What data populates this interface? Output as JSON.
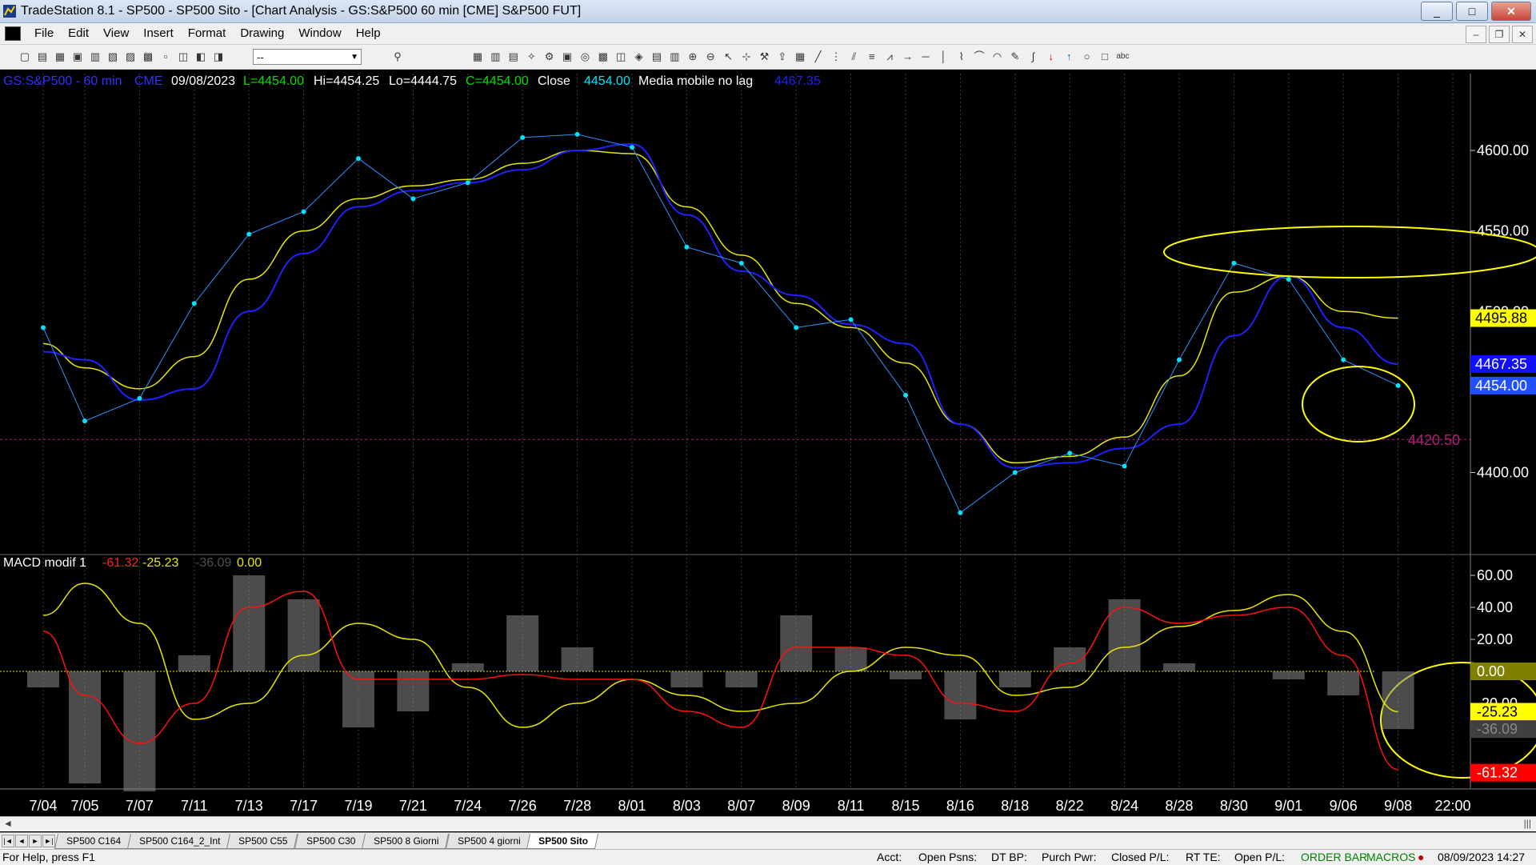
{
  "window": {
    "title": "TradeStation 8.1 - SP500 - SP500 Sito - [Chart Analysis - GS:S&P500  60 min  [CME] S&P500 FUT]",
    "btn_minimize": "_",
    "btn_maximize": "□",
    "btn_close": "✕"
  },
  "menu": {
    "items": [
      "File",
      "Edit",
      "View",
      "Insert",
      "Format",
      "Drawing",
      "Window",
      "Help"
    ],
    "mdi_min": "–",
    "mdi_restore": "❐",
    "mdi_close": "✕"
  },
  "toolbar": {
    "symbol_select": "--"
  },
  "chart": {
    "header": {
      "symbol": "GS:S&P500 - 60 min",
      "exchange": "CME",
      "date": "09/08/2023",
      "last": "L=4454.00",
      "high": "Hi=4454.25",
      "low": "Lo=4444.75",
      "close_val": "C=4454.00",
      "close_label": "Close",
      "close_price": "4454.00",
      "indicator_name": "Media mobile no lag",
      "indicator_value": "4467.35"
    },
    "price_axis": [
      "4600.00",
      "4550.00",
      "4500.00",
      "4400.00"
    ],
    "price_markers": {
      "yellow_ma": "4495.88",
      "blue_ma": "4467.35",
      "last": "4454.00",
      "hline": "4420.50"
    },
    "macd_header": {
      "name": "MACD modif 1",
      "v1": "-61.32",
      "v2": "-25.23",
      "v3": "-36.09",
      "v4": "0.00"
    },
    "macd_axis": [
      "60.00",
      "40.00",
      "20.00",
      "-20.00"
    ],
    "macd_markers": {
      "zero": "0.00",
      "yellow": "-25.23",
      "hist": "-36.09",
      "red": "-61.32"
    },
    "colors": {
      "price_dots": "#00e5ff",
      "blue_ma": "#2020ff",
      "yellow_ma": "#e6e600",
      "macd_red": "#ff1010",
      "macd_yellow": "#e6e600",
      "hist": "#8a8a8a",
      "hline": "#b0207a"
    }
  },
  "chart_data": {
    "type": "line",
    "x": [
      "7/04",
      "7/05",
      "7/07",
      "7/11",
      "7/13",
      "7/17",
      "7/19",
      "7/21",
      "7/24",
      "7/26",
      "7/28",
      "8/01",
      "8/03",
      "8/07",
      "8/09",
      "8/11",
      "8/15",
      "8/16",
      "8/18",
      "8/22",
      "8/24",
      "8/28",
      "8/30",
      "9/01",
      "9/06",
      "9/08",
      "22:00"
    ],
    "series": [
      {
        "values": [
          4490,
          4432,
          4446,
          4505,
          4548,
          4562,
          4595,
          4570,
          4580,
          4608,
          4610,
          4602,
          4540,
          4530,
          4490,
          4495,
          4448,
          4375,
          4400,
          4412,
          4404,
          4470,
          4530,
          4520,
          4470,
          4454,
          null
        ]
      },
      {
        "values": [
          4480,
          4465,
          4452,
          4472,
          4520,
          4550,
          4570,
          4578,
          4582,
          4592,
          4600,
          4598,
          4565,
          4535,
          4505,
          4490,
          4468,
          4430,
          4406,
          4410,
          4422,
          4460,
          4512,
          4522,
          4500,
          4495.88,
          null
        ]
      },
      {
        "values": [
          4475,
          4470,
          4445,
          4452,
          4500,
          4536,
          4565,
          4575,
          4580,
          4588,
          4600,
          4604,
          4560,
          4525,
          4510,
          4492,
          4480,
          4430,
          4403,
          4406,
          4415,
          4430,
          4485,
          4522,
          4490,
          4467.35,
          null
        ]
      }
    ],
    "macd": {
      "series": [
        {
          "values": [
            25,
            -15,
            -45,
            -20,
            40,
            50,
            -5,
            -5,
            -5,
            -2,
            -5,
            -5,
            -25,
            -35,
            15,
            15,
            10,
            -20,
            -25,
            5,
            40,
            30,
            35,
            40,
            10,
            -61.32,
            null
          ]
        },
        {
          "values": [
            35,
            55,
            30,
            -30,
            -20,
            10,
            30,
            20,
            -10,
            -35,
            -20,
            -5,
            -15,
            -25,
            -20,
            0,
            15,
            10,
            -15,
            -10,
            15,
            28,
            38,
            48,
            25,
            -25.23,
            null
          ]
        }
      ],
      "histogram": [
        -10,
        -70,
        -75,
        10,
        60,
        45,
        -35,
        -25,
        5,
        35,
        15,
        0,
        -10,
        -10,
        35,
        15,
        -5,
        -30,
        -10,
        15,
        45,
        5,
        0,
        -5,
        -15,
        -36.09,
        null
      ]
    },
    "ylim": [
      4370,
      4630
    ],
    "macd_ylim": [
      -70,
      60
    ]
  },
  "tabs": {
    "items": [
      "SP500 C164",
      "SP500 C164_2_Int",
      "SP500 C55",
      "SP500 C30",
      "SP500 8 Giorni",
      "SP500 4 giorni",
      "SP500 Sito"
    ],
    "active": 6
  },
  "status": {
    "help": "For Help, press F1",
    "acct": "Acct:",
    "open_psns": "Open Psns:",
    "dt_bp": "DT BP:",
    "purch_pwr": "Purch Pwr:",
    "closed_pl": "Closed P/L:",
    "rt_te": "RT TE:",
    "open_pl": "Open P/L:",
    "order_bar": "ORDER BAR",
    "macros": "MACROS",
    "datetime": "08/09/2023 14:27"
  }
}
